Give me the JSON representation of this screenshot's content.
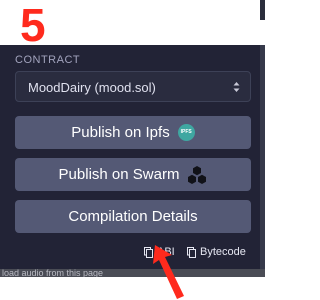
{
  "annotation": {
    "step_number": "5",
    "color": "#ff2a1d"
  },
  "panel": {
    "contract_label": "CONTRACT",
    "selected_contract": "MoodDairy (mood.sol)",
    "buttons": {
      "publish_ipfs": "Publish on Ipfs",
      "ipfs_badge": "IPFS",
      "publish_swarm": "Publish on Swarm",
      "compilation_details": "Compilation Details"
    },
    "links": {
      "abi": "ABI",
      "bytecode": "Bytecode"
    },
    "icons": [
      "chevron-updown-icon",
      "ipfs-icon",
      "swarm-icon",
      "copy-icon"
    ]
  },
  "footer": {
    "status_text": "load audio from this page"
  },
  "colors": {
    "panel_bg": "#222336",
    "button_bg": "#545975",
    "text": "#ffffff",
    "label": "#a2a3bd"
  }
}
